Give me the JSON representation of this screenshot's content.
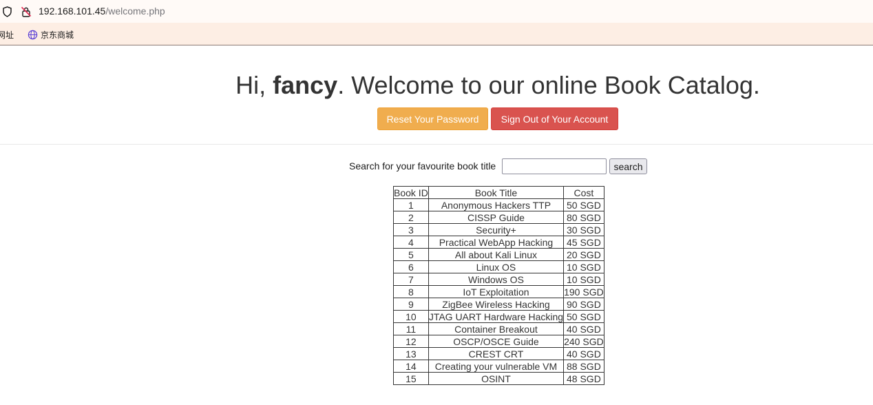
{
  "browser": {
    "url_host": "192.168.101.45",
    "url_path": "/welcome.php",
    "bookmarks": [
      {
        "label": "网址"
      },
      {
        "label": "京东商城"
      }
    ]
  },
  "page": {
    "greeting_prefix": "Hi, ",
    "username": "fancy",
    "greeting_suffix": ". Welcome to our online Book Catalog.",
    "reset_button": "Reset Your Password",
    "signout_button": "Sign Out of Your Account",
    "search_label": "Search for your favourite book title",
    "search_value": "",
    "search_button": "search"
  },
  "table": {
    "headers": [
      "Book ID",
      "Book Title",
      "Cost"
    ],
    "rows": [
      [
        "1",
        "Anonymous Hackers TTP",
        "50 SGD"
      ],
      [
        "2",
        "CISSP Guide",
        "80 SGD"
      ],
      [
        "3",
        "Security+",
        "30 SGD"
      ],
      [
        "4",
        "Practical WebApp Hacking",
        "45 SGD"
      ],
      [
        "5",
        "All about Kali Linux",
        "20 SGD"
      ],
      [
        "6",
        "Linux OS",
        "10 SGD"
      ],
      [
        "7",
        "Windows OS",
        "10 SGD"
      ],
      [
        "8",
        "IoT Exploitation",
        "190 SGD"
      ],
      [
        "9",
        "ZigBee Wireless Hacking",
        "90 SGD"
      ],
      [
        "10",
        "JTAG UART Hardware Hacking",
        "50 SGD"
      ],
      [
        "11",
        "Container Breakout",
        "40 SGD"
      ],
      [
        "12",
        "OSCP/OSCE Guide",
        "240 SGD"
      ],
      [
        "13",
        "CREST CRT",
        "40 SGD"
      ],
      [
        "14",
        "Creating your vulnerable VM",
        "88 SGD"
      ],
      [
        "15",
        "OSINT",
        "48 SGD"
      ]
    ]
  },
  "colors": {
    "reset_button": "#f0ad4e",
    "signout_button": "#d9534f",
    "text": "#333333"
  },
  "icons": {
    "site_info": "shield-icon",
    "insecure": "insecure-lock-icon",
    "bookmark": "globe-icon"
  }
}
